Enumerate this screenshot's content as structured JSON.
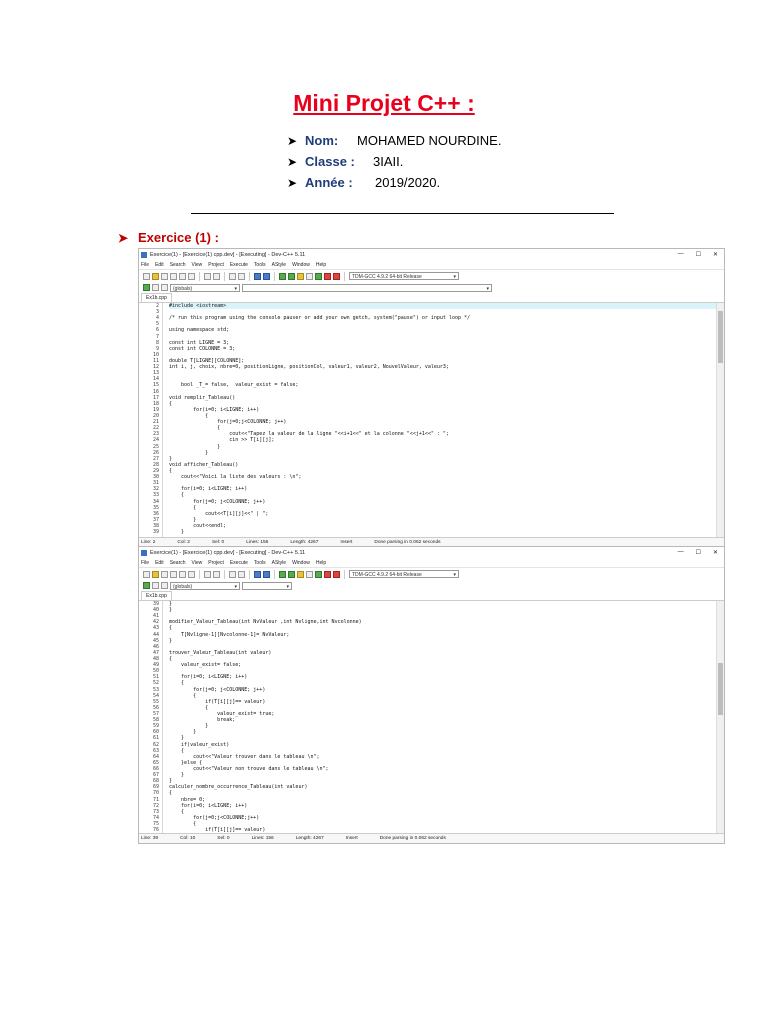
{
  "document": {
    "title": "Mini Projet C++ :",
    "info": [
      {
        "label": "Nom:",
        "value": "MOHAMED NOURDINE."
      },
      {
        "label": "Classe :",
        "value": "3IAII."
      },
      {
        "label": "Année :",
        "value": "2019/2020."
      }
    ],
    "section": "Exercice (1) :"
  },
  "ide1": {
    "title": "Exercice(1) - [Exercice(1) cpp.dev] - [Executing] - Dev-C++ 5.11",
    "menu": [
      "File",
      "Edit",
      "Search",
      "View",
      "Project",
      "Execute",
      "Tools",
      "AStyle",
      "Window",
      "Help"
    ],
    "scope_combo": "(globals)",
    "compiler_combo": "TDM-GCC 4.9.2 64-bit Release",
    "tab": "Ex1b.cpp",
    "lines": [
      {
        "n": "2",
        "t": "#include <iostream>"
      },
      {
        "n": "3",
        "t": ""
      },
      {
        "n": "4",
        "t": "/* run this program using the console pauser or add your own getch, system(\"pause\") or input loop */"
      },
      {
        "n": "5",
        "t": ""
      },
      {
        "n": "6",
        "t": "using namespace std;"
      },
      {
        "n": "7",
        "t": ""
      },
      {
        "n": "8",
        "t": "const int LIGNE = 3;"
      },
      {
        "n": "9",
        "t": "const int COLONNE = 3;"
      },
      {
        "n": "10",
        "t": ""
      },
      {
        "n": "11",
        "t": "double T[LIGNE][COLONNE];"
      },
      {
        "n": "12",
        "t": "int i, j, choix, nbre=0, positionLigne, positionCol, valeur1, valeur2, NouvelValeur, valeur3;"
      },
      {
        "n": "13",
        "t": ""
      },
      {
        "n": "14",
        "t": ""
      },
      {
        "n": "15",
        "t": "    bool _T_= false,  valeur_exist = false;"
      },
      {
        "n": "16",
        "t": ""
      },
      {
        "n": "17",
        "t": "void remplir_Tableau()"
      },
      {
        "n": "18",
        "t": "{"
      },
      {
        "n": "19",
        "t": "        for(i=0; i<LIGNE; i++)"
      },
      {
        "n": "20",
        "t": "            {"
      },
      {
        "n": "21",
        "t": "                for(j=0;j<COLONNE; j++)"
      },
      {
        "n": "22",
        "t": "                {"
      },
      {
        "n": "23",
        "t": "                    cout<<\"Tapez la valeur de la ligne \"<<i+1<<\" et la colonne \"<<j+1<<\" : \";"
      },
      {
        "n": "24",
        "t": "                    cin >> T[i][j];"
      },
      {
        "n": "25",
        "t": "                }"
      },
      {
        "n": "26",
        "t": "            }"
      },
      {
        "n": "27",
        "t": "}"
      },
      {
        "n": "28",
        "t": "void afficher_Tableau()"
      },
      {
        "n": "29",
        "t": "{"
      },
      {
        "n": "30",
        "t": "    cout<<\"Voici la liste des valeurs : \\n\";"
      },
      {
        "n": "31",
        "t": ""
      },
      {
        "n": "32",
        "t": "    for(i=0; i<LIGNE; i++)"
      },
      {
        "n": "33",
        "t": "    {"
      },
      {
        "n": "34",
        "t": "        for(j=0; j<COLONNE; j++)"
      },
      {
        "n": "35",
        "t": "        {"
      },
      {
        "n": "36",
        "t": "            cout<<T[i][j]<<\" | \";"
      },
      {
        "n": "37",
        "t": "        }"
      },
      {
        "n": "38",
        "t": "        cout<<endl;"
      },
      {
        "n": "39",
        "t": "    }"
      }
    ],
    "status": [
      "Line:   2",
      "Col:   2",
      "Sel:   0",
      "Lines:   156",
      "Length:  4267",
      "Insert",
      "Done parsing in 0.062 seconds"
    ]
  },
  "ide2": {
    "title": "Exercice(1) - [Exercice(1) cpp.dev] - [Executing] - Dev-C++ 5.11",
    "menu": [
      "File",
      "Edit",
      "Search",
      "View",
      "Project",
      "Execute",
      "Tools",
      "AStyle",
      "Window",
      "Help"
    ],
    "scope_combo": "(globals)",
    "compiler_combo": "TDM-GCC 4.9.2 64-bit Release",
    "tab": "Ex1b.cpp",
    "lines": [
      {
        "n": "39",
        "t": "}"
      },
      {
        "n": "40",
        "t": "}"
      },
      {
        "n": "41",
        "t": ""
      },
      {
        "n": "42",
        "t": "modifier_Valeur_Tableau(int NvValeur ,int Nvligne,int Nvcolonne)"
      },
      {
        "n": "43",
        "t": "{"
      },
      {
        "n": "44",
        "t": "    T[Nvligne-1][Nvcolonne-1]= NvValeur;"
      },
      {
        "n": "45",
        "t": "}"
      },
      {
        "n": "46",
        "t": ""
      },
      {
        "n": "47",
        "t": "trouver_Valeur_Tableau(int valeur)"
      },
      {
        "n": "48",
        "t": "{"
      },
      {
        "n": "49",
        "t": "    valeur_exist= false;"
      },
      {
        "n": "50",
        "t": ""
      },
      {
        "n": "51",
        "t": "    for(i=0; i<LIGNE; i++)"
      },
      {
        "n": "52",
        "t": "    {"
      },
      {
        "n": "53",
        "t": "        for(j=0; j<COLONNE; j++)"
      },
      {
        "n": "54",
        "t": "        {"
      },
      {
        "n": "55",
        "t": "            if(T[i][j]== valeur)"
      },
      {
        "n": "56",
        "t": "            {"
      },
      {
        "n": "57",
        "t": "                valeur_exist= true;"
      },
      {
        "n": "58",
        "t": "                break;"
      },
      {
        "n": "59",
        "t": "            }"
      },
      {
        "n": "60",
        "t": "        }"
      },
      {
        "n": "61",
        "t": "    }"
      },
      {
        "n": "62",
        "t": "    if(valeur_exist)"
      },
      {
        "n": "63",
        "t": "    {"
      },
      {
        "n": "64",
        "t": "        cout<<\"Valeur trouver dans le tableau \\n\";"
      },
      {
        "n": "65",
        "t": "    }else {"
      },
      {
        "n": "66",
        "t": "        cout<<\"Valeur non trouve dans le tableau \\n\";"
      },
      {
        "n": "67",
        "t": "    }"
      },
      {
        "n": "68",
        "t": "}"
      },
      {
        "n": "69",
        "t": "calculer_nombre_occurrence_Tableau(int valeur)"
      },
      {
        "n": "70",
        "t": "{"
      },
      {
        "n": "71",
        "t": "    nbre= 0;"
      },
      {
        "n": "72",
        "t": "    for(i=0; i<LIGNE; i++)"
      },
      {
        "n": "73",
        "t": "    {"
      },
      {
        "n": "74",
        "t": "        for(j=0;j<COLONNE;j++)"
      },
      {
        "n": "75",
        "t": "        {"
      },
      {
        "n": "76",
        "t": "            if(T[i][j]== valeur)"
      },
      {
        "n": "77",
        "t": "            {"
      }
    ],
    "status": [
      "Line:   39",
      "Col:   10",
      "Sel:   0",
      "Lines:   156",
      "Length:  4267",
      "Insert",
      "Done parsing in 0.062 seconds"
    ]
  }
}
